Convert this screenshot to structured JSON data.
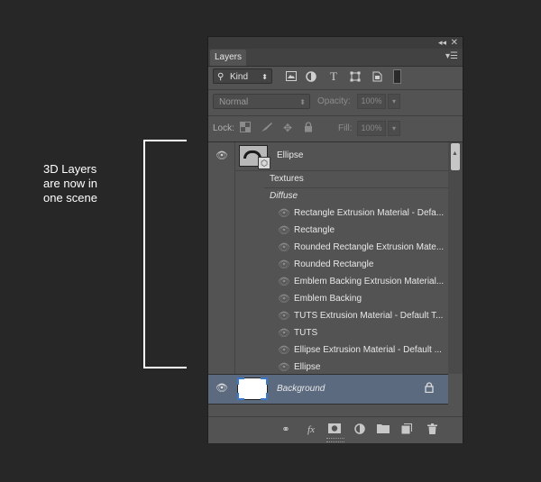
{
  "annotation": {
    "lines": [
      "3D Layers",
      "are now in",
      "one scene"
    ]
  },
  "panel": {
    "tab_label": "Layers",
    "filter": {
      "kind_label": "Kind",
      "icons": [
        "image-filter-icon",
        "adjustment-filter-icon",
        "type-filter-icon",
        "shape-filter-icon",
        "smart-object-filter-icon",
        "filter-toggle-icon"
      ]
    },
    "blend": {
      "mode": "Normal",
      "opacity_label": "Opacity:",
      "opacity_value": "100%"
    },
    "lock": {
      "label": "Lock:",
      "fill_label": "Fill:",
      "fill_value": "100%"
    },
    "layers": {
      "ellipse": "Ellipse",
      "textures": "Textures",
      "diffuse": "Diffuse",
      "materials": [
        "Rectangle Extrusion Material - Defa...",
        "Rectangle",
        "Rounded Rectangle Extrusion Mate...",
        "Rounded Rectangle",
        "Emblem Backing Extrusion Material...",
        "Emblem Backing",
        "TUTS Extrusion Material - Default T...",
        "TUTS",
        "Ellipse Extrusion Material - Default ...",
        "Ellipse"
      ],
      "background": "Background"
    },
    "footer_icons": [
      "link-layers-icon",
      "fx-icon",
      "mask-icon",
      "adjustment-layer-icon",
      "group-folder-icon",
      "new-layer-icon",
      "trash-icon"
    ]
  },
  "colors": {
    "page_bg": "#272727",
    "panel_bg": "#535353",
    "selected_layer": "#5c6a80"
  }
}
